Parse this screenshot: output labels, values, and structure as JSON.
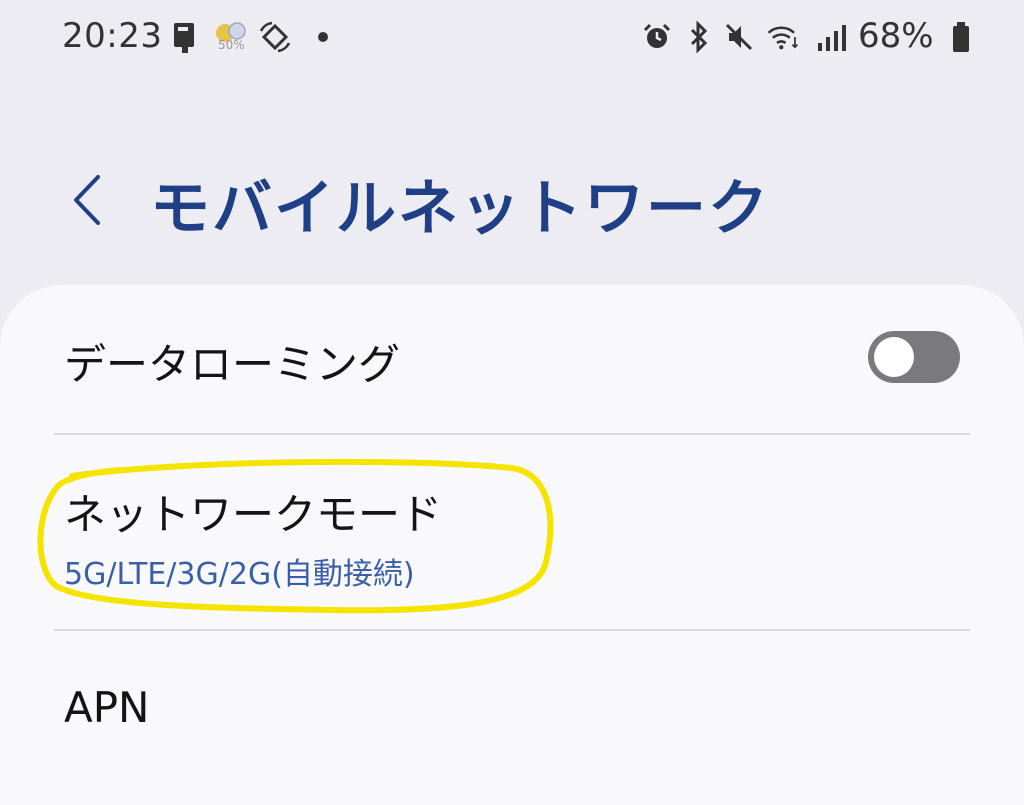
{
  "status_bar": {
    "time": "20:23",
    "weather_temp": "50%",
    "battery": "68%",
    "icons": [
      "notification-icon",
      "weather-icon",
      "rotation-icon",
      "dot-icon",
      "alarm-icon",
      "bluetooth-icon",
      "mute-icon",
      "wifi-icon",
      "signal-icon",
      "battery-icon"
    ]
  },
  "header": {
    "back_icon": "chevron-left-icon",
    "title": "モバイルネットワーク",
    "title_color": "#1f3f86"
  },
  "settings": {
    "data_roaming": {
      "label": "データローミング",
      "enabled": false
    },
    "network_mode": {
      "label": "ネットワークモード",
      "value": "5G/LTE/3G/2G(自動接続)"
    },
    "apn": {
      "label": "APN"
    }
  },
  "colors": {
    "accent": "#3a5fa9",
    "highlight": "#f5e400",
    "toggle_off": "#7a7a7e"
  }
}
